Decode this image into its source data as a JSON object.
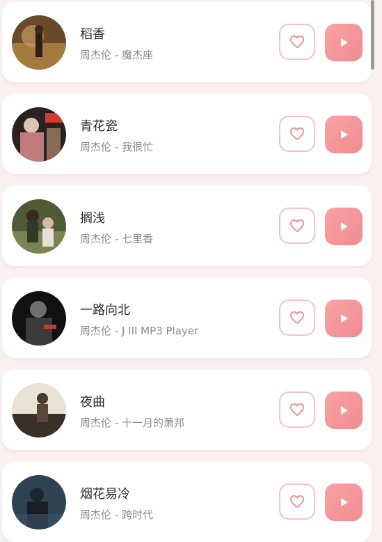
{
  "songs": [
    {
      "title": "稻香",
      "subtitle": "周杰伦 - 魔杰座"
    },
    {
      "title": "青花瓷",
      "subtitle": "周杰伦 - 我很忙"
    },
    {
      "title": "搁浅",
      "subtitle": "周杰伦 - 七里香"
    },
    {
      "title": "一路向北",
      "subtitle": "周杰伦 - J III MP3 Player"
    },
    {
      "title": "夜曲",
      "subtitle": "周杰伦 - 十一月的萧邦"
    },
    {
      "title": "烟花易冷",
      "subtitle": "周杰伦 - 跨时代"
    }
  ],
  "icons": {
    "favorite": "heart-outline-icon",
    "play": "play-icon"
  },
  "colors": {
    "background": "#fbf1f1",
    "card": "#ffffff",
    "accent": "#f39a9d",
    "favorite_border": "#f3c2c4",
    "title_text": "#2b2b2b",
    "subtitle_text": "#8a8a8a"
  }
}
